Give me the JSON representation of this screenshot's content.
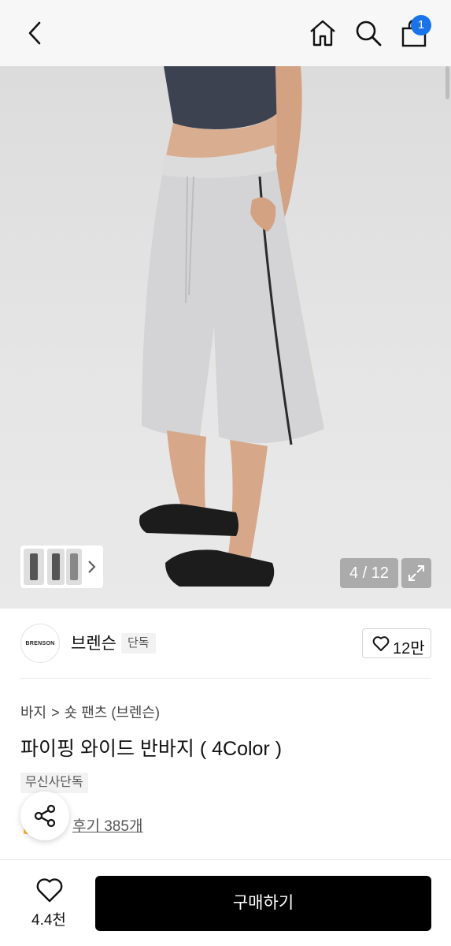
{
  "header": {
    "back_icon": "chevron-left-icon",
    "home_icon": "home-icon",
    "search_icon": "search-icon",
    "cart_icon": "shopping-bag-icon",
    "cart_count": "1",
    "badge_color": "#1a73e8"
  },
  "gallery": {
    "counter": "4 / 12",
    "expand_icon": "expand-icon",
    "thumb_arrow_icon": "chevron-right-icon"
  },
  "brand": {
    "logo_text": "BRENSON",
    "name": "브렌슨",
    "tag": "단독",
    "likes": "12만"
  },
  "product": {
    "breadcrumb": [
      "바지",
      "숏 팬츠 (브렌슨)"
    ],
    "title": "파이핑 와이드 반바지 ( 4Color )",
    "exclusive_tag": "무신사단독",
    "review_link": "후기 385개"
  },
  "bottom": {
    "wishlist_count": "4.4천",
    "buy_label": "구매하기",
    "buy_color": "#000000"
  }
}
